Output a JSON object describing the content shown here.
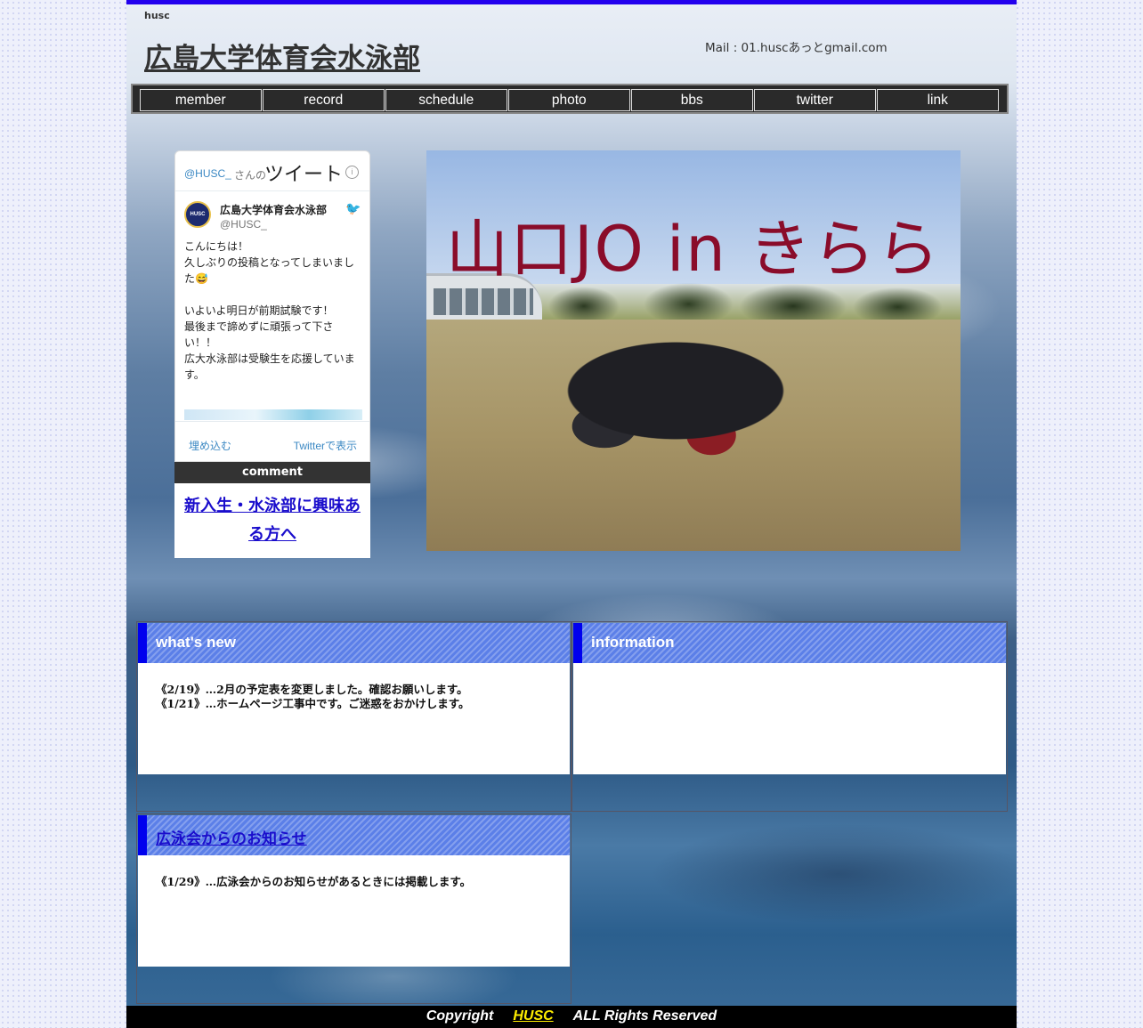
{
  "site": {
    "id": "husc",
    "title": "広島大学体育会水泳部",
    "mail": "Mail : 01.huscあっとgmail.com"
  },
  "nav": [
    "member",
    "record",
    "schedule",
    "photo",
    "bbs",
    "twitter",
    "link"
  ],
  "twitter": {
    "handle": "@HUSC_",
    "handle_suffix": "さんの",
    "header_title": "ツイート",
    "info_icon": "info-icon",
    "avatar_text": "HUSC",
    "account_name": "広島大学体育会水泳部",
    "account_user": "@HUSC_",
    "tweet_text": "こんにちは！\n久しぶりの投稿となってしまいました😅\n\nいよいよ明日が前期試験です！\n最後まで諦めずに頑張って下さい！！\n広大水泳部は受験生を応援しています。",
    "embed_label": "埋め込む",
    "view_label": "Twitterで表示"
  },
  "comment": {
    "header": "comment",
    "link_text": "新入生・水泳部に興味ある方へ"
  },
  "hero": {
    "caption": "山口JO in きらら"
  },
  "panels": {
    "whats_new": {
      "title": "what's new",
      "items": [
        "《2/19》…2月の予定表を変更しました。確認お願いします。",
        "《1/21》…ホームページ工事中です。ご迷惑をおかけします。"
      ]
    },
    "information": {
      "title": "information"
    },
    "kouei": {
      "title": "広泳会からのお知らせ",
      "items": [
        "《1/29》…広泳会からのお知らせがあるときには掲載します。"
      ]
    }
  },
  "footer": {
    "prefix": "Copyright",
    "link": "HUSC",
    "suffix": "ALL Rights Reserved"
  },
  "colors": {
    "top_bar": "#2200ee",
    "panel_accent": "#0000ee",
    "panel_header": "#5b7fe8",
    "link": "#1a0dcc",
    "footer_link": "#ffee00"
  }
}
